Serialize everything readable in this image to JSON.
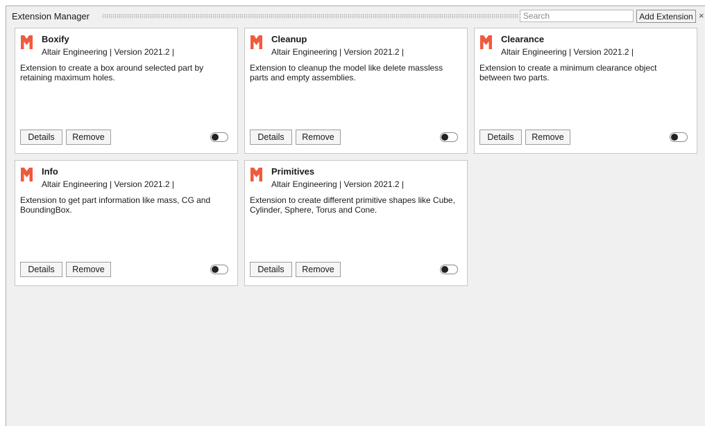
{
  "header": {
    "title": "Extension Manager",
    "search_placeholder": "Search",
    "add_button_label": "Add Extension",
    "close_label": "×"
  },
  "buttons": {
    "details_label": "Details",
    "remove_label": "Remove"
  },
  "colors": {
    "logo": "#f05a3c",
    "panel_bg": "#f0f0f0"
  },
  "extensions": [
    {
      "name": "Boxify",
      "meta": "Altair Engineering | Version 2021.2 |",
      "description": "Extension to create a box around selected part by retaining maximum holes.",
      "enabled": false
    },
    {
      "name": "Cleanup",
      "meta": "Altair Engineering | Version 2021.2 |",
      "description": "Extension to cleanup the model like delete massless parts and empty assemblies.",
      "enabled": false
    },
    {
      "name": "Clearance",
      "meta": "Altair Engineering | Version 2021.2 |",
      "description": "Extension to create a minimum clearance object between two parts.",
      "enabled": false
    },
    {
      "name": "Info",
      "meta": "Altair Engineering | Version 2021.2 |",
      "description": "Extension to get part information like mass, CG and BoundingBox.",
      "enabled": false
    },
    {
      "name": "Primitives",
      "meta": "Altair Engineering | Version 2021.2 |",
      "description": "Extension to create different primitive shapes like Cube, Cylinder, Sphere, Torus and Cone.",
      "enabled": false
    }
  ]
}
